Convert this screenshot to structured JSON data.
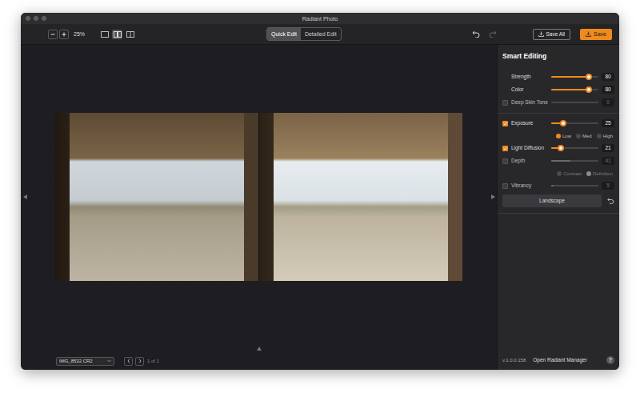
{
  "window": {
    "title": "Radiant Photo"
  },
  "toolbar": {
    "zoom": "25%",
    "view_modes": [
      {
        "selected": false
      },
      {
        "selected": true
      },
      {
        "selected": false
      }
    ],
    "edit_modes": [
      {
        "label": "Quick Edit",
        "selected": true
      },
      {
        "label": "Detailed Edit",
        "selected": false
      }
    ],
    "undo_disabled": false,
    "redo_disabled": true,
    "save_all": "Save All",
    "save": "Save"
  },
  "bottom_bar": {
    "file": "IMG_8532.CR2",
    "page": "1 of 1"
  },
  "panel": {
    "title": "Smart Editing",
    "sections": [
      {
        "controls": [
          {
            "kind": "slider",
            "label": "Strength",
            "value": "80",
            "level": 0.8
          },
          {
            "kind": "slider",
            "label": "Color",
            "value": "80",
            "level": 0.8
          },
          {
            "kind": "check-slider",
            "label": "Deep Skin Tone",
            "checked": false,
            "value": "0",
            "level": 0
          }
        ]
      },
      {
        "controls": [
          {
            "kind": "check-slider",
            "label": "Exposure",
            "checked": true,
            "value": "25",
            "level": 0.25
          },
          {
            "kind": "radios",
            "disabled": false,
            "options": [
              {
                "label": "Low",
                "selected": true
              },
              {
                "label": "Med",
                "selected": false
              },
              {
                "label": "High",
                "selected": false
              }
            ]
          },
          {
            "kind": "check-slider",
            "label": "Light Diffusion",
            "checked": true,
            "value": "21",
            "level": 0.21
          },
          {
            "kind": "check-slider",
            "label": "Depth",
            "checked": false,
            "value": "41",
            "level": 0.41
          },
          {
            "kind": "radios",
            "disabled": true,
            "options": [
              {
                "label": "Contrast",
                "selected": false
              },
              {
                "label": "Definition",
                "selected": true
              }
            ]
          },
          {
            "kind": "check-slider",
            "label": "Vibrancy",
            "checked": false,
            "value": "5",
            "level": 0.05
          },
          {
            "kind": "preset",
            "label": "Landscape"
          }
        ]
      }
    ]
  },
  "footer": {
    "version": "v.1.0.0.158",
    "manager": "Open Radiant Manager",
    "help": "?"
  }
}
